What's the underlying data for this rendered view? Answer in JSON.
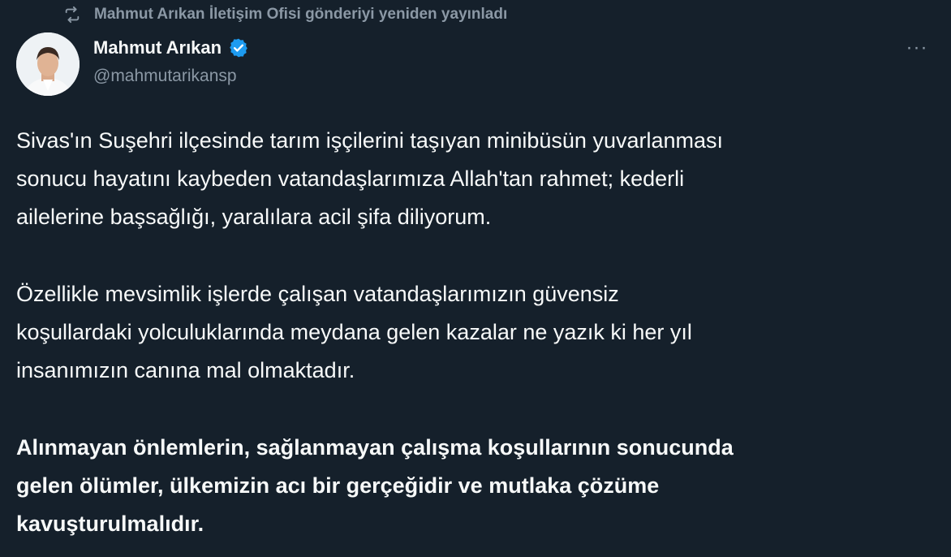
{
  "retweet": {
    "text": "Mahmut Arıkan İletişim Ofisi gönderiyi yeniden yayınladı",
    "icon": "retweet-icon"
  },
  "author": {
    "name": "Mahmut Arıkan",
    "handle": "@mahmutarikansp",
    "verified": true,
    "verified_color": "#1d9bf0"
  },
  "more": {
    "label": "···",
    "icon": "more-icon"
  },
  "tweet": {
    "paragraphs": [
      "Sivas'ın Suşehri ilçesinde tarım işçilerini taşıyan minibüsün yuvarlanması\nsonucu hayatını kaybeden vatandaşlarımıza Allah'tan rahmet; kederli\nailelerine başsağlığı, yaralılara acil şifa diliyorum.",
      "Özellikle mevsimlik işlerde çalışan vatandaşlarımızın güvensiz\nkoşullardaki yolculuklarında meydana gelen kazalar ne yazık ki her yıl\ninsanımızın canına mal olmaktadır.",
      "Alınmayan önlemlerin, sağlanmayan çalışma koşullarının sonucunda\ngelen ölümler, ülkemizin acı bir gerçeğidir ve mutlaka çözüme\nkavuşturulmalıdır."
    ]
  },
  "colors": {
    "background": "#15202b",
    "text": "#f7f9f9",
    "secondary": "#8b98a5",
    "accent": "#1d9bf0"
  }
}
